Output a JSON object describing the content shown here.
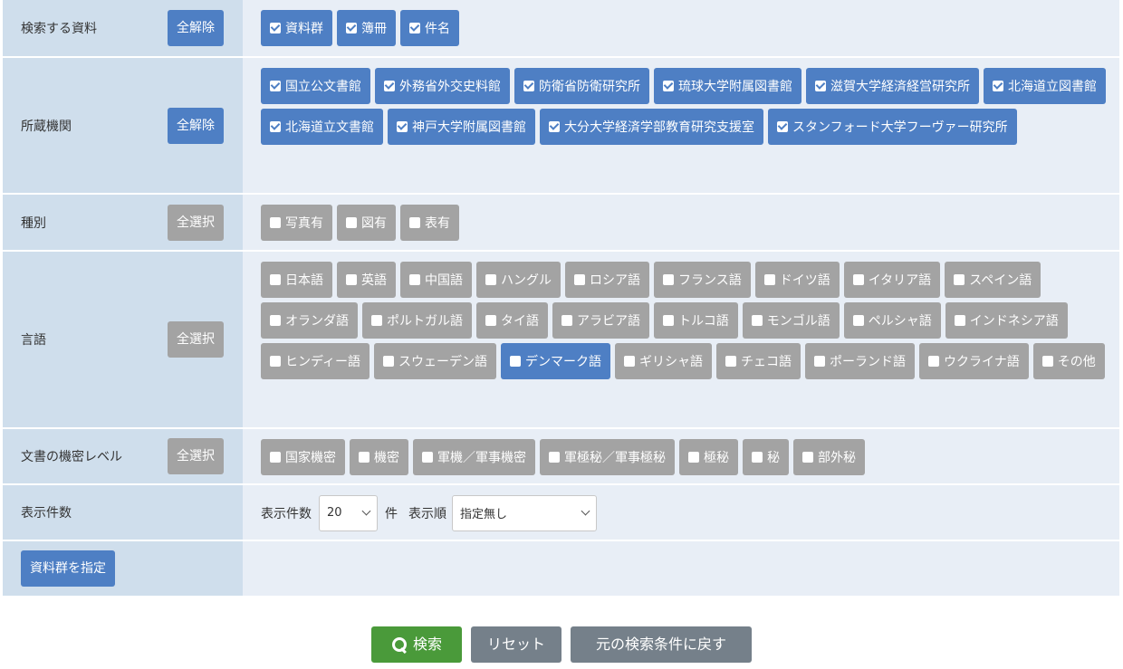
{
  "rows": {
    "materials": {
      "label": "検索する資料",
      "button": "全解除",
      "items": [
        {
          "label": "資料群",
          "checked": true
        },
        {
          "label": "簿冊",
          "checked": true
        },
        {
          "label": "件名",
          "checked": true
        }
      ]
    },
    "institutions": {
      "label": "所蔵機関",
      "button": "全解除",
      "items": [
        {
          "label": "国立公文書館",
          "checked": true
        },
        {
          "label": "外務省外交史料館",
          "checked": true
        },
        {
          "label": "防衛省防衛研究所",
          "checked": true
        },
        {
          "label": "琉球大学附属図書館",
          "checked": true
        },
        {
          "label": "滋賀大学経済経営研究所",
          "checked": true
        },
        {
          "label": "北海道立図書館",
          "checked": true
        },
        {
          "label": "北海道立文書館",
          "checked": true
        },
        {
          "label": "神戸大学附属図書館",
          "checked": true
        },
        {
          "label": "大分大学経済学部教育研究支援室",
          "checked": true
        },
        {
          "label": "スタンフォード大学フーヴァー研究所",
          "checked": true
        }
      ]
    },
    "type": {
      "label": "種別",
      "button": "全選択",
      "items": [
        {
          "label": "写真有",
          "checked": false
        },
        {
          "label": "図有",
          "checked": false
        },
        {
          "label": "表有",
          "checked": false
        }
      ]
    },
    "language": {
      "label": "言語",
      "button": "全選択",
      "items": [
        {
          "label": "日本語",
          "checked": false
        },
        {
          "label": "英語",
          "checked": false
        },
        {
          "label": "中国語",
          "checked": false
        },
        {
          "label": "ハングル",
          "checked": false
        },
        {
          "label": "ロシア語",
          "checked": false
        },
        {
          "label": "フランス語",
          "checked": false
        },
        {
          "label": "ドイツ語",
          "checked": false
        },
        {
          "label": "イタリア語",
          "checked": false
        },
        {
          "label": "スペイン語",
          "checked": false
        },
        {
          "label": "オランダ語",
          "checked": false
        },
        {
          "label": "ポルトガル語",
          "checked": false
        },
        {
          "label": "タイ語",
          "checked": false
        },
        {
          "label": "アラビア語",
          "checked": false
        },
        {
          "label": "トルコ語",
          "checked": false
        },
        {
          "label": "モンゴル語",
          "checked": false
        },
        {
          "label": "ペルシャ語",
          "checked": false
        },
        {
          "label": "インドネシア語",
          "checked": false
        },
        {
          "label": "ヒンディー語",
          "checked": false
        },
        {
          "label": "スウェーデン語",
          "checked": false
        },
        {
          "label": "デンマーク語",
          "checked": false,
          "highlighted": true
        },
        {
          "label": "ギリシャ語",
          "checked": false
        },
        {
          "label": "チェコ語",
          "checked": false
        },
        {
          "label": "ポーランド語",
          "checked": false
        },
        {
          "label": "ウクライナ語",
          "checked": false
        },
        {
          "label": "その他",
          "checked": false
        }
      ]
    },
    "secrecy": {
      "label": "文書の機密レベル",
      "button": "全選択",
      "items": [
        {
          "label": "国家機密",
          "checked": false
        },
        {
          "label": "機密",
          "checked": false
        },
        {
          "label": "軍機／軍事機密",
          "checked": false
        },
        {
          "label": "軍極秘／軍事極秘",
          "checked": false
        },
        {
          "label": "極秘",
          "checked": false
        },
        {
          "label": "秘",
          "checked": false
        },
        {
          "label": "部外秘",
          "checked": false
        }
      ]
    },
    "display": {
      "label": "表示件数",
      "count_label": "表示件数",
      "count_value": "20",
      "count_unit": "件",
      "order_label": "表示順",
      "order_value": "指定無し"
    },
    "group": {
      "button": "資料群を指定"
    }
  },
  "actions": {
    "search": "検索",
    "reset": "リセット",
    "back": "元の検索条件に戻す"
  },
  "icons": {
    "search": "search-icon",
    "checkbox": "checkbox-icon",
    "dropdown": "chevron-down-icon"
  },
  "colors": {
    "selected_chip": "#4e7fc4",
    "unselected_chip": "#a3a3a3",
    "search_button": "#4a9a3a",
    "secondary_button": "#75808a"
  }
}
